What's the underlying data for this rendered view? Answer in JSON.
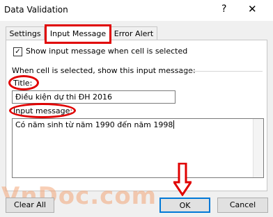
{
  "window": {
    "title": "Data Validation",
    "help_glyph": "?",
    "close_glyph": "✕"
  },
  "tabs": [
    {
      "label": "Settings",
      "active": false
    },
    {
      "label": "Input Message",
      "active": true
    },
    {
      "label": "Error Alert",
      "active": false
    }
  ],
  "input_message": {
    "show_checkbox": {
      "label": "Show input message when cell is selected",
      "checked": true
    },
    "group_label": "When cell is selected, show this input message:",
    "title_label": "Title:",
    "title_value": "Điều kiện dự thi ĐH 2016",
    "message_label": "Input message:",
    "message_value": "Có năm sinh từ năm 1990 đến năm 1998"
  },
  "buttons": {
    "clear_all": "Clear All",
    "ok": "OK",
    "cancel": "Cancel"
  },
  "watermark": "VnDoc.com",
  "colors": {
    "highlight": "#e00000",
    "ok_border": "#0078d7"
  }
}
